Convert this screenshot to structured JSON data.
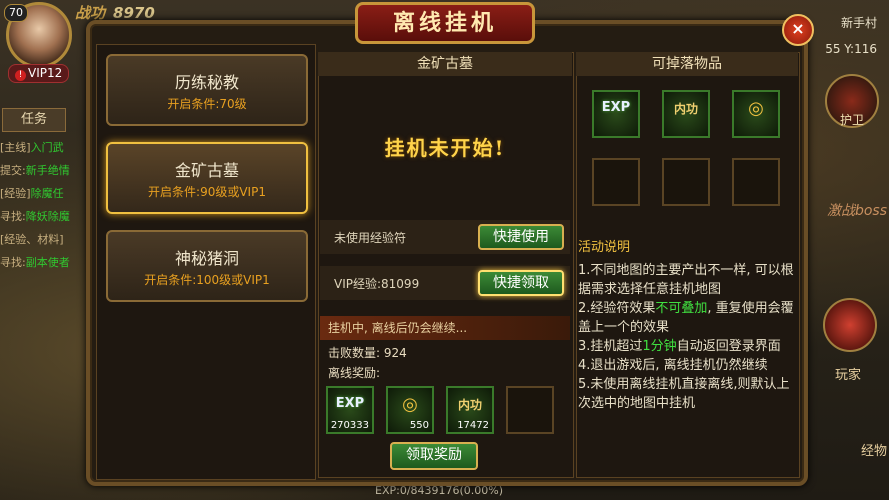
{
  "hud": {
    "level": "70",
    "vip": "VIP12",
    "vip_alert": "!",
    "power_label": "战功",
    "power_value": "8970",
    "task_tab": "任务",
    "tasks": [
      {
        "tag": "[主线]",
        "text": "入门武"
      },
      {
        "tag": "提交:",
        "text": "新手绝情"
      },
      {
        "tag": "[经验]",
        "text": "除魔任"
      },
      {
        "tag": "寻找:",
        "text": "降妖除魔"
      },
      {
        "tag": "[经验、材料]",
        "text": ""
      },
      {
        "tag": "寻找:",
        "text": "副本使者"
      }
    ],
    "map_name": "新手村",
    "coords": "55 Y:116",
    "guard_label": "护卫",
    "boss_label": "激战boss",
    "player_label": "玩家",
    "mail_label": "经物",
    "exp_text": "EXP:0/8439176(0.00%)"
  },
  "panel": {
    "title": "离线挂机",
    "close": "×",
    "stages": [
      {
        "name": "历练秘教",
        "cond": "开启条件:70级"
      },
      {
        "name": "金矿古墓",
        "cond": "开启条件:90级或VIP1"
      },
      {
        "name": "神秘猪洞",
        "cond": "开启条件:100级或VIP1"
      }
    ],
    "current_map": "金矿古墓",
    "idle_text": "挂机未开始!",
    "unused_exp_label": "未使用经验符",
    "quick_use": "快捷使用",
    "vip_exp_label": "VIP经验:81099",
    "quick_claim": "快捷领取",
    "status": "挂机中, 离线后仍会继续...",
    "kills": "击败数量: 924",
    "reward_label": "离线奖励:",
    "rewards": [
      {
        "icon": "EXP",
        "count": "270333"
      },
      {
        "icon": "◎",
        "count": "550"
      },
      {
        "icon": "内功",
        "count": "17472"
      }
    ],
    "claim_button": "领取奖励",
    "drops_title": "可掉落物品",
    "drops": [
      "EXP",
      "内功",
      "◎"
    ],
    "desc_title": "活动说明",
    "desc": {
      "p1": "1.不同地图的主要产出不一样, 可以根据需求选择任意挂机地图",
      "p2a": "2.经验符效果",
      "p2b": "不可叠加",
      "p2c": ", 重复使用会覆盖上一个的效果",
      "p3a": "3.挂机超过",
      "p3b": "1分钟",
      "p3c": "自动返回登录界面",
      "p4": "4.退出游戏后, 离线挂机仍然继续",
      "p5": "5.未使用离线挂机直接离线,则默认上次选中的地图中挂机"
    }
  }
}
